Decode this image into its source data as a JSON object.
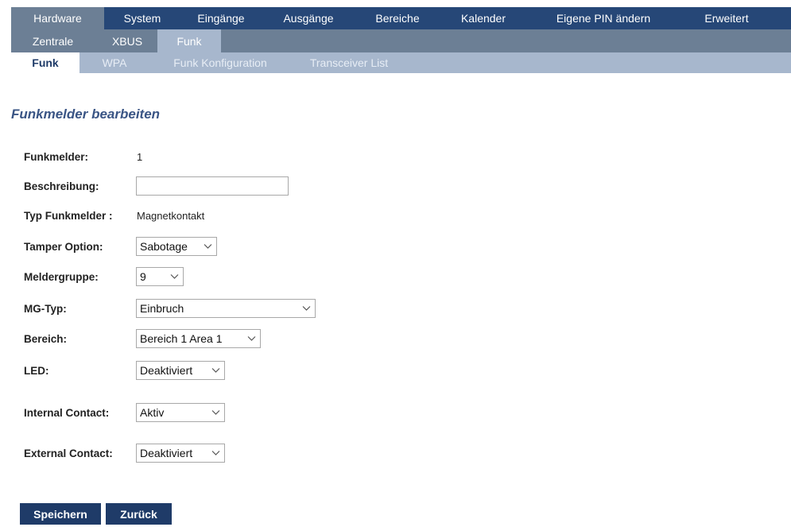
{
  "nav": {
    "main_tabs": [
      "Hardware",
      "System",
      "Eingänge",
      "Ausgänge",
      "Bereiche",
      "Kalender",
      "Eigene PIN ändern",
      "Erweitert"
    ],
    "sub_tabs": [
      "Zentrale",
      "XBUS",
      "Funk"
    ],
    "third_tabs": [
      "Funk",
      "WPA",
      "Funk Konfiguration",
      "Transceiver List"
    ]
  },
  "page": {
    "title": "Funkmelder bearbeiten"
  },
  "form": {
    "funkmelder": {
      "label": "Funkmelder:",
      "value": "1"
    },
    "beschreibung": {
      "label": "Beschreibung:",
      "value": ""
    },
    "typ": {
      "label": "Typ Funkmelder :",
      "value": "Magnetkontakt"
    },
    "tamper": {
      "label": "Tamper Option:",
      "value": "Sabotage"
    },
    "meldergruppe": {
      "label": "Meldergruppe:",
      "value": "9"
    },
    "mgtyp": {
      "label": "MG-Typ:",
      "value": "Einbruch"
    },
    "bereich": {
      "label": "Bereich:",
      "value": "Bereich 1 Area 1"
    },
    "led": {
      "label": "LED:",
      "value": "Deaktiviert"
    },
    "internal": {
      "label": "Internal Contact:",
      "value": "Aktiv"
    },
    "external": {
      "label": "External Contact:",
      "value": "Deaktiviert"
    }
  },
  "buttons": {
    "save": "Speichern",
    "back": "Zurück"
  },
  "colors": {
    "nav_top": "#264777",
    "nav_mid": "#6c7f95",
    "nav_low": "#a7b7cd",
    "button": "#1f3b68",
    "title": "#3a5585"
  }
}
